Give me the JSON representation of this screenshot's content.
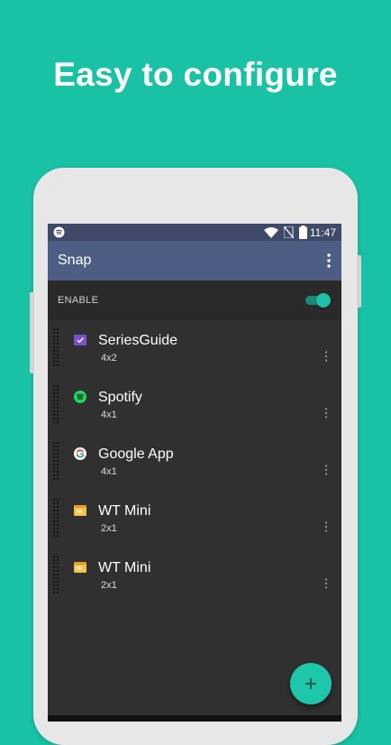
{
  "headline": "Easy to configure",
  "status_bar": {
    "time": "11:47",
    "icons": [
      "spotify-icon",
      "wifi-icon",
      "no-sim-icon",
      "battery-icon"
    ]
  },
  "app_bar": {
    "title": "Snap",
    "menu_icon": "more-vert-icon"
  },
  "enable": {
    "label": "ENABLE",
    "enabled": true
  },
  "widgets": [
    {
      "name": "SeriesGuide",
      "size": "4x2",
      "icon": "seriesguide-icon"
    },
    {
      "name": "Spotify",
      "size": "4x1",
      "icon": "spotify-icon"
    },
    {
      "name": "Google App",
      "size": "4x1",
      "icon": "google-icon"
    },
    {
      "name": "WT Mini",
      "size": "2x1",
      "icon": "wt-mini-icon"
    },
    {
      "name": "WT Mini",
      "size": "2x1",
      "icon": "wt-mini-icon"
    }
  ],
  "fab": {
    "icon": "plus-icon"
  },
  "colors": {
    "background": "#19c1a5",
    "status_bar": "#3e4a68",
    "app_bar": "#4d5d84",
    "screen_bg": "#303030",
    "accent": "#1fc7aa"
  }
}
